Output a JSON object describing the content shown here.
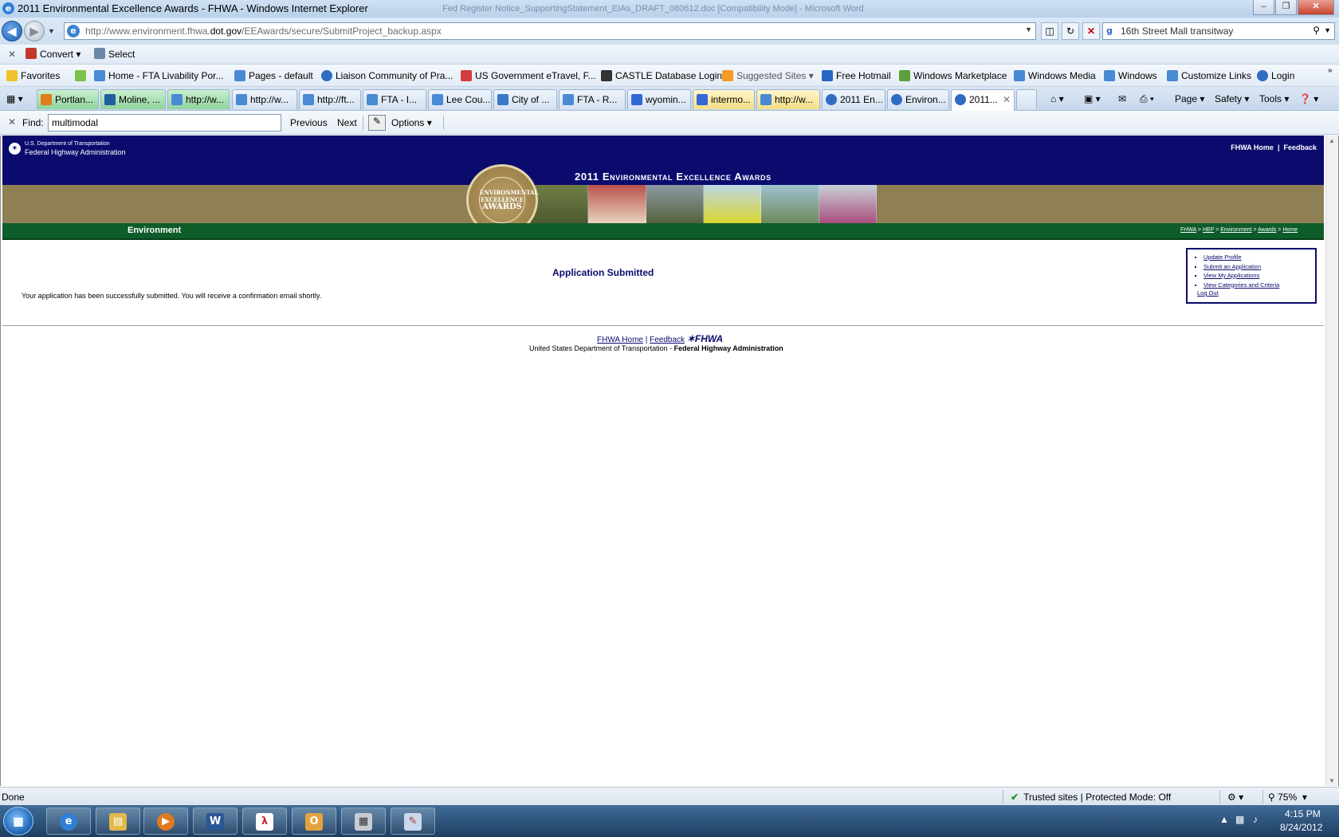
{
  "window": {
    "title": "2011 Environmental Excellence Awards - FHWA - Windows Internet Explorer",
    "background_title": "Fed Register Notice_SupportingStatement_EIAs_DRAFT_080612.doc [Compatibility Mode] - Microsoft Word"
  },
  "address_bar": {
    "url_prefix": "http://www.environment.fhwa.",
    "url_domain": "dot.gov",
    "url_suffix": "/EEAwards/secure/SubmitProject_backup.aspx",
    "search_text": "16th Street Mall transitway"
  },
  "convert_bar": {
    "convert_label": "Convert",
    "select_label": "Select"
  },
  "favorites_bar": {
    "favorites_label": "Favorites",
    "items": [
      "Home - FTA Livability Por...",
      "Pages - default",
      "Liaison Community of Pra...",
      "US Government eTravel, F...",
      "CASTLE Database Login",
      "Suggested Sites",
      "Free Hotmail",
      "Windows Marketplace",
      "Windows Media",
      "Windows",
      "Customize Links",
      "Login"
    ]
  },
  "tabs": [
    "Portlan...",
    "Moline, ...",
    "http://w...",
    "http://w...",
    "http://ft...",
    "FTA - I...",
    "Lee Cou...",
    "City of ...",
    "FTA - R...",
    "wyomin...",
    "intermo...",
    "http://w...",
    "2011 En...",
    "Environ...",
    "2011..."
  ],
  "command_bar": {
    "page": "Page",
    "safety": "Safety",
    "tools": "Tools"
  },
  "find_bar": {
    "label": "Find:",
    "value": "multimodal",
    "previous": "Previous",
    "next": "Next",
    "options": "Options"
  },
  "page": {
    "dot_line1": "U.S. Department of Transportation",
    "dot_line2": "Federal Highway Administration",
    "top_link_home": "FHWA Home",
    "top_link_feedback": "Feedback",
    "banner_title": "2011 Environmental Excellence Awards",
    "seal_line1": "ENVIRONMENTAL",
    "seal_line2": "EXCELLENCE",
    "seal_line3": "AWARDS",
    "section_label": "Environment",
    "breadcrumbs": [
      "FHWA",
      "HEP",
      "Environment",
      "Awards",
      "Home"
    ],
    "heading": "Application Submitted",
    "message": "Your application has been successfully submitted. You will receive a confirmation email shortly.",
    "side_menu": [
      "Update Profile",
      "Submit an Application",
      "View My Applications",
      "View Categories and Criteria"
    ],
    "logout": "Log Out",
    "footer_home": "FHWA Home",
    "footer_feedback": "Feedback",
    "footer_logo": "FHWA",
    "footer_dept": "United States Department of Transportation - ",
    "footer_agency": "Federal Highway Administration"
  },
  "status_bar": {
    "status": "Done",
    "zone": "Trusted sites | Protected Mode: Off",
    "zoom": "75%"
  },
  "taskbar": {
    "time": "4:15 PM",
    "date": "8/24/2012"
  }
}
